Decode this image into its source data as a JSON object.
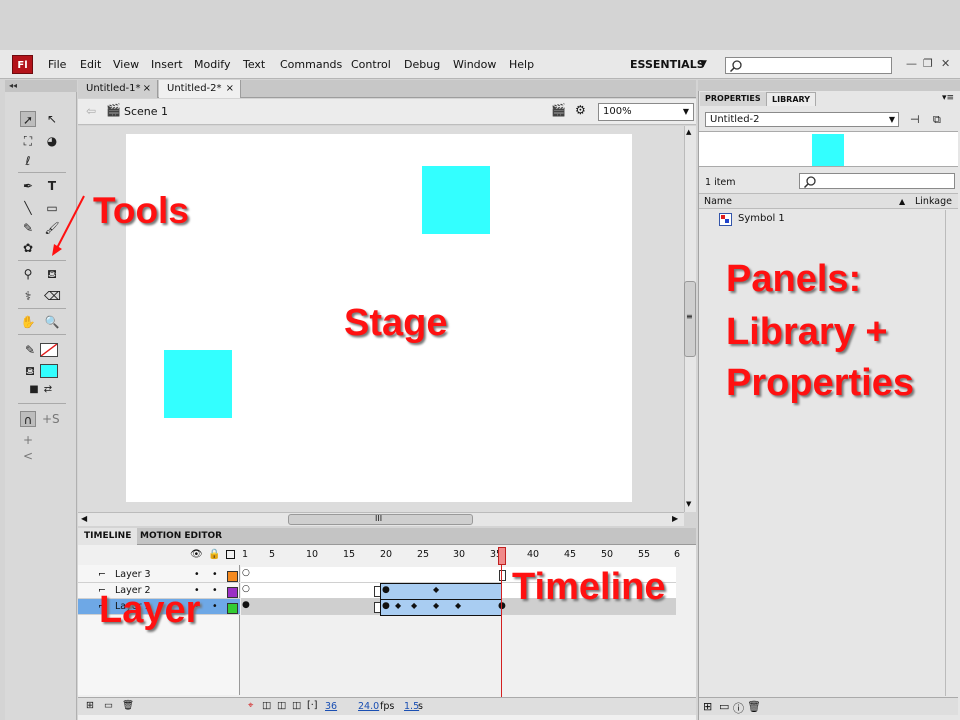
{
  "app": {
    "logo": "Fl"
  },
  "menu": [
    "File",
    "Edit",
    "View",
    "Insert",
    "Modify",
    "Text",
    "Commands",
    "Control",
    "Debug",
    "Window",
    "Help"
  ],
  "workspace": {
    "label": "ESSENTIALS",
    "arrow": "▼",
    "search_placeholder": "",
    "minimize": "—",
    "restore": "❐"
  },
  "tools": {
    "collapse": "◂◂"
  },
  "tabs": [
    {
      "label": "Untitled-1*",
      "close": "×"
    },
    {
      "label": "Untitled-2*",
      "close": "×"
    }
  ],
  "scene": {
    "back": "⇦",
    "label": "Scene 1",
    "zoom": "100%",
    "zoom_arrow": "▼"
  },
  "scrollbar": {
    "grip_h": "III",
    "grip_v": "≡"
  },
  "timeline": {
    "tabs": [
      "TIMELINE",
      "MOTION EDITOR"
    ],
    "frame_numbers": [
      "1",
      "5",
      "10",
      "15",
      "20",
      "25",
      "30",
      "35",
      "40",
      "45",
      "50",
      "55",
      "6"
    ],
    "layers": [
      "Layer 3",
      "Layer 2",
      "Layer 1"
    ],
    "layer_colors": [
      "#f58a1f",
      "#9b2fc4",
      "#33cc33"
    ],
    "status": {
      "frame": "36",
      "fps": "24.0",
      "fps_unit": "fps",
      "time": "1.5",
      "time_unit": "s"
    }
  },
  "panel": {
    "tabs": [
      "PROPERTIES",
      "LIBRARY"
    ],
    "library_doc": "Untitled-2",
    "item_count": "1 item",
    "col_name": "Name",
    "col_linkage": "Linkage",
    "items": [
      "Symbol 1"
    ]
  },
  "annotations": {
    "tools": "Tools",
    "stage": "Stage",
    "panels_line1": "Panels:",
    "panels_line2": "Library +",
    "panels_line3": "Properties",
    "timeline": "Timeline",
    "layer": "Layer"
  },
  "colors": {
    "symbol_fill": "#33ffff",
    "annotation": "#ff1111",
    "playhead": "#d32020",
    "logo_bg": "#b3131a"
  }
}
